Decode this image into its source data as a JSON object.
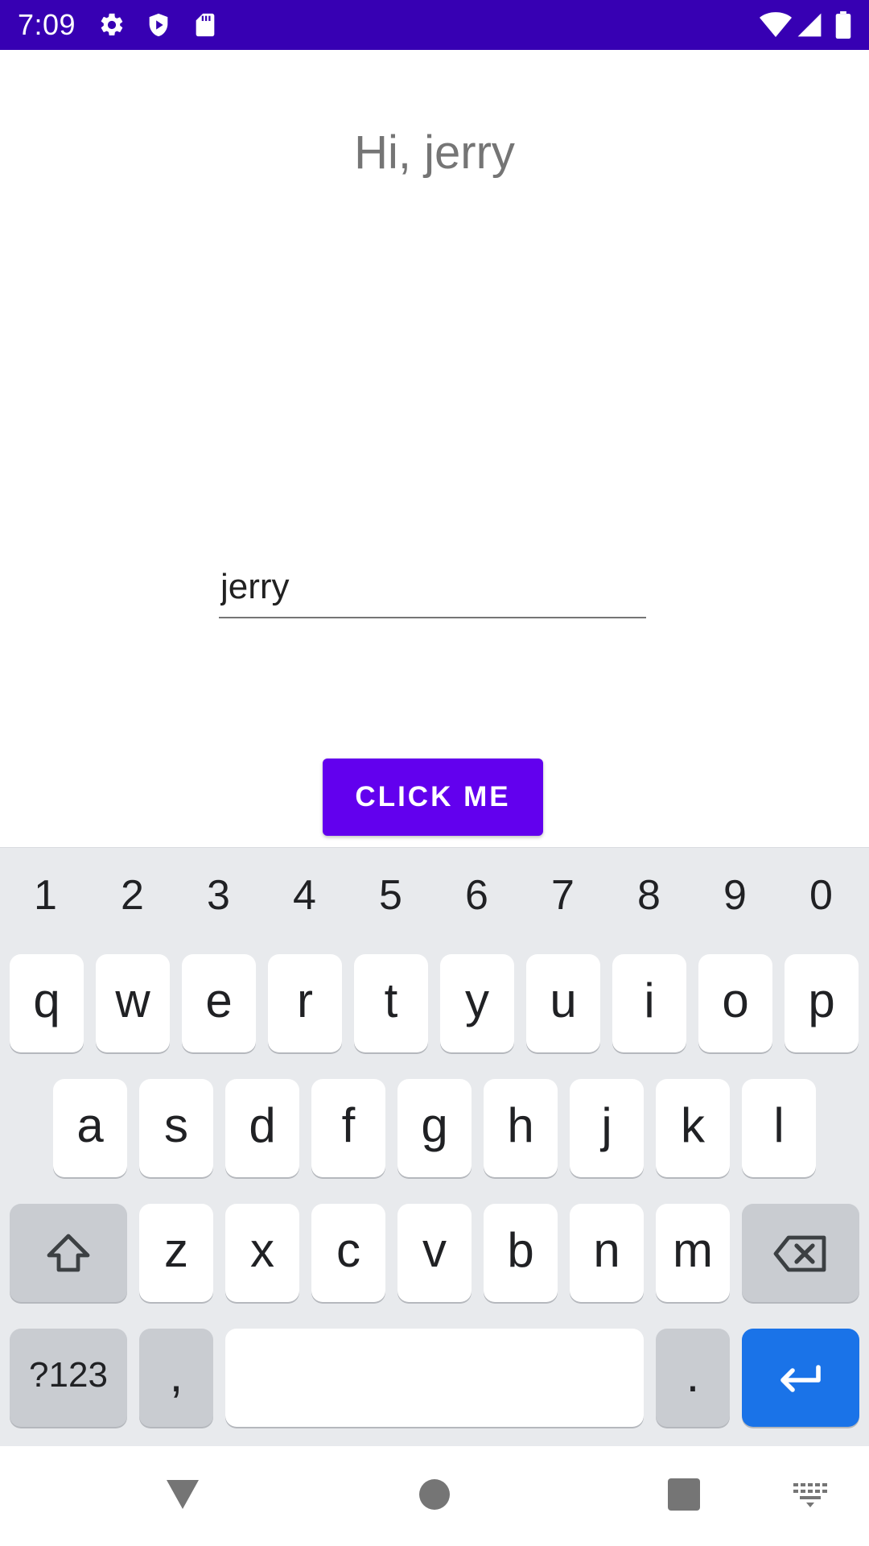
{
  "status_bar": {
    "time": "7:09",
    "background_color": "#3700b3",
    "left_icons": [
      "settings-gear-icon",
      "shield-play-icon",
      "sd-card-icon"
    ],
    "right_icons": [
      "wifi-icon",
      "cell-signal-icon",
      "battery-icon"
    ]
  },
  "main": {
    "greeting": "Hi, jerry",
    "name_input_value": "jerry",
    "button_label": "CLICK ME",
    "button_color": "#6200ee"
  },
  "keyboard": {
    "number_row": [
      "1",
      "2",
      "3",
      "4",
      "5",
      "6",
      "7",
      "8",
      "9",
      "0"
    ],
    "row1": [
      "q",
      "w",
      "e",
      "r",
      "t",
      "y",
      "u",
      "i",
      "o",
      "p"
    ],
    "row2": [
      "a",
      "s",
      "d",
      "f",
      "g",
      "h",
      "j",
      "k",
      "l"
    ],
    "row3": [
      "z",
      "x",
      "c",
      "v",
      "b",
      "n",
      "m"
    ],
    "symbols_label": "?123",
    "comma_label": ",",
    "period_label": ".",
    "shift_icon": "shift-arrow-icon",
    "backspace_icon": "backspace-icon",
    "enter_icon": "enter-arrow-icon",
    "enter_color": "#1a73e8"
  },
  "nav_bar": {
    "icons": [
      "back-triangle-icon",
      "home-circle-icon",
      "recents-square-icon",
      "keyboard-switch-icon"
    ]
  }
}
